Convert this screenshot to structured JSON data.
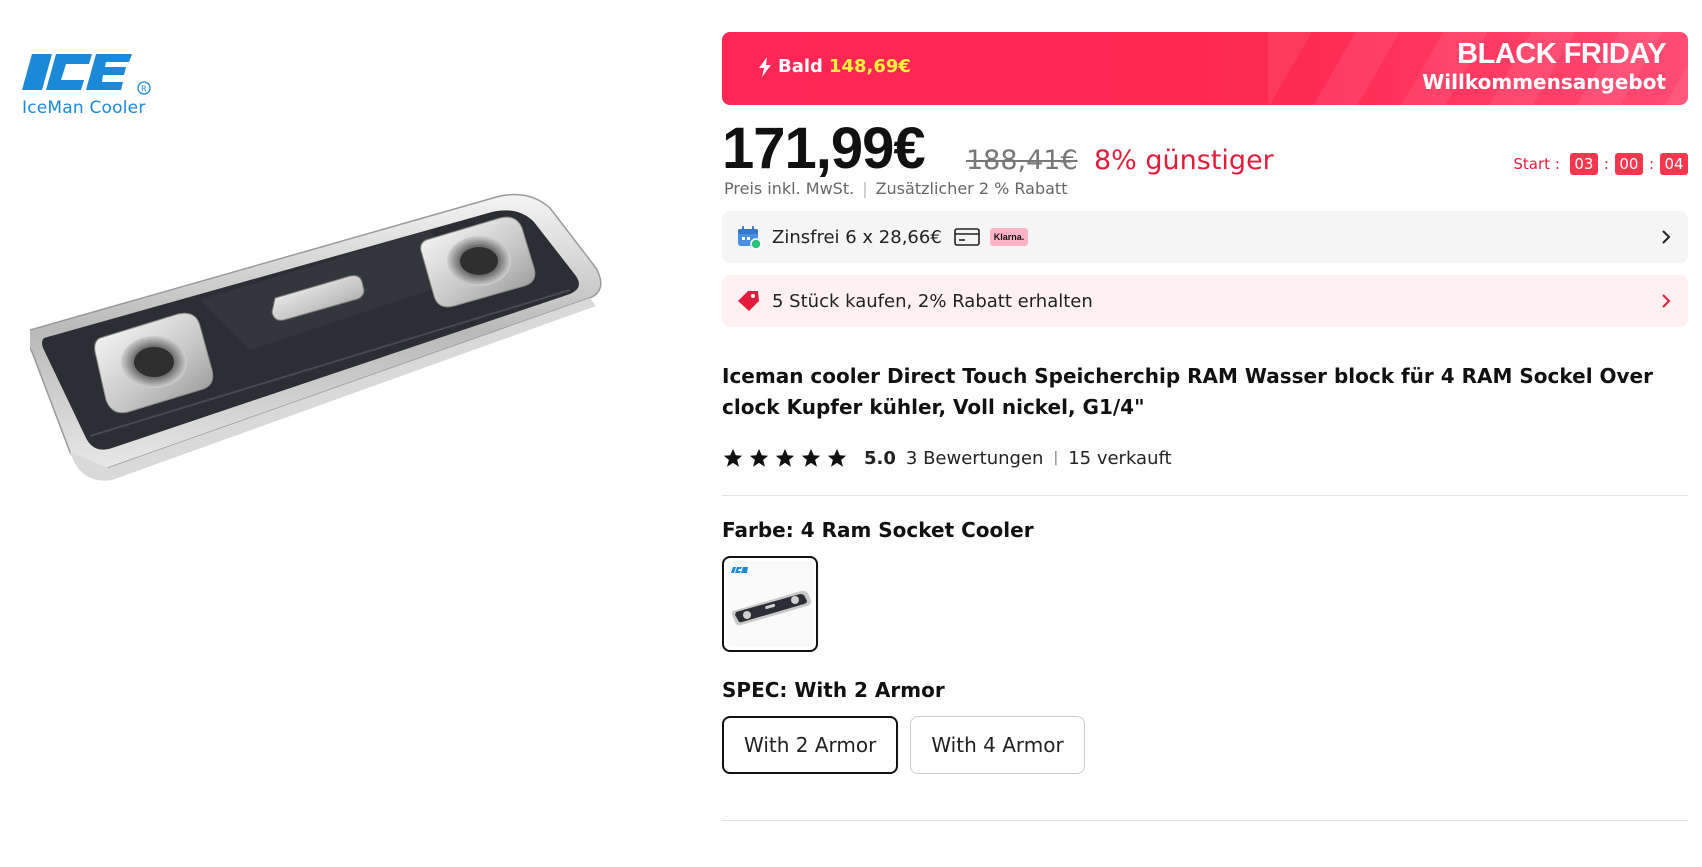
{
  "brand": {
    "logo_text": "IceMan Cooler",
    "logo_icon": "iceman-logo-icon"
  },
  "promo": {
    "soon_label": "Bald",
    "soon_price": "148,69€",
    "title": "BLACK FRIDAY",
    "subtitle": "Willkommensangebot",
    "icon": "bolt-icon",
    "colors": {
      "bg": "#fe2655",
      "price": "#fff23a"
    }
  },
  "price": {
    "current": "171,99€",
    "original": "188,41€",
    "discount": "8% günstiger",
    "note": "Preis inkl. MwSt.",
    "extra": "Zusätzlicher 2 % Rabatt"
  },
  "countdown": {
    "label": "Start :",
    "hours": "03",
    "minutes": "00",
    "seconds": "04"
  },
  "installments": {
    "text": "Zinsfrei 6 x 28,66€",
    "klarna": "Klarna.",
    "icons": [
      "calendar-icon",
      "card-icon",
      "chevron-right-icon"
    ]
  },
  "bulk": {
    "text": "5 Stück kaufen, 2% Rabatt erhalten",
    "icons": [
      "tag-icon",
      "chevron-right-icon"
    ]
  },
  "product": {
    "title": "Iceman cooler Direct Touch Speicherchip RAM Wasser block für 4 RAM Sockel Over clock Kupfer kühler, Voll nickel, G1/4\""
  },
  "rating": {
    "stars": 5,
    "score": "5.0",
    "reviews": "3 Bewertungen",
    "sold": "15 verkauft"
  },
  "color": {
    "label": "Farbe: 4 Ram Socket Cooler"
  },
  "spec": {
    "label": "SPEC: With 2 Armor",
    "options": [
      {
        "label": "With 2 Armor",
        "selected": true
      },
      {
        "label": "With 4 Armor",
        "selected": false
      }
    ]
  }
}
